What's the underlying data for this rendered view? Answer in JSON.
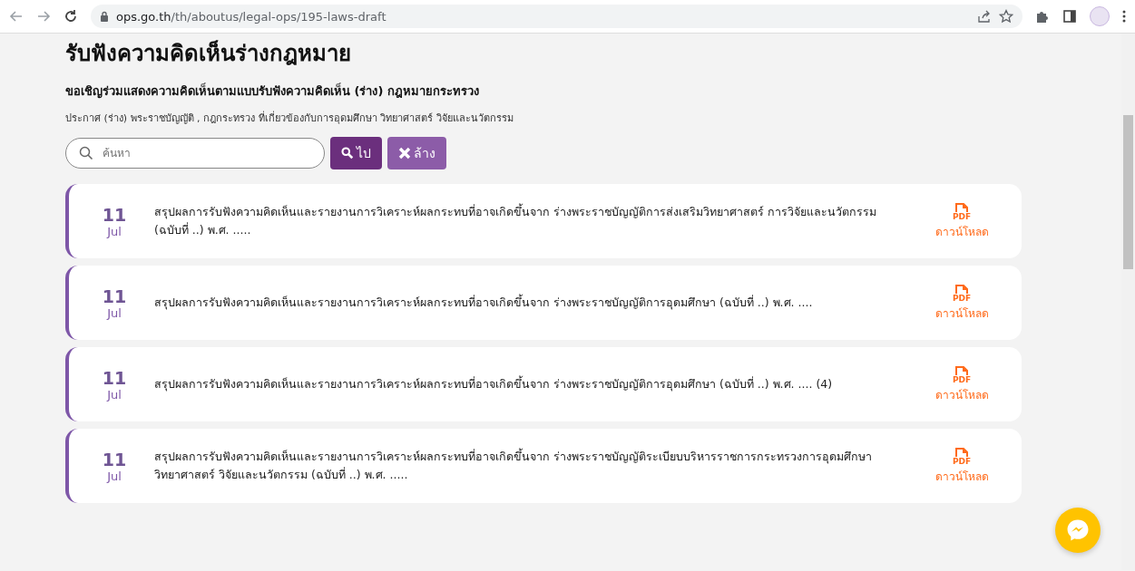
{
  "browser": {
    "url_host": "ops.go.th",
    "url_path": "/th/aboutus/legal-ops/195-laws-draft"
  },
  "page": {
    "title": "รับฟังความคิดเห็นร่างกฎหมาย",
    "subtitle": "ขอเชิญร่วมแสดงความคิดเห็นตามแบบรับฟังความคิดเห็น (ร่าง) กฎหมายกระทรวง",
    "description": "ประกาศ (ร่าง) พระราชบัญญัติ , กฎกระทรวง ที่เกี่ยวข้องกับการอุดมศึกษา วิทยาศาสตร์ วิจัยและนวัตกรรม"
  },
  "search": {
    "placeholder": "ค้นหา",
    "go_button": "ไป",
    "clear_button": "ล้าง"
  },
  "items": [
    {
      "day": "11",
      "month": "Jul",
      "title": "สรุปผลการรับฟังความคิดเห็นและรายงานการวิเคราะห์ผลกระทบที่อาจเกิดขึ้นจาก ร่างพระราชบัญญัติการส่งเสริมวิทยาศาสตร์ การวิจัยและนวัตกรรม (ฉบับที่ ..) พ.ศ. .....",
      "pdf_label": "PDF",
      "download": "ดาวน์โหลด"
    },
    {
      "day": "11",
      "month": "Jul",
      "title": "สรุปผลการรับฟังความคิดเห็นและรายงานการวิเคราะห์ผลกระทบที่อาจเกิดขึ้นจาก ร่างพระราชบัญญัติการอุดมศึกษา (ฉบับที่ ..) พ.ศ. ....",
      "pdf_label": "PDF",
      "download": "ดาวน์โหลด"
    },
    {
      "day": "11",
      "month": "Jul",
      "title": "สรุปผลการรับฟังความคิดเห็นและรายงานการวิเคราะห์ผลกระทบที่อาจเกิดขึ้นจาก ร่างพระราชบัญญัติการอุดมศึกษา (ฉบับที่ ..) พ.ศ. .... (4)",
      "pdf_label": "PDF",
      "download": "ดาวน์โหลด"
    },
    {
      "day": "11",
      "month": "Jul",
      "title": "สรุปผลการรับฟังความคิดเห็นและรายงานการวิเคราะห์ผลกระทบที่อาจเกิดขึ้นจาก ร่างพระราชบัญญัติระเบียบบริหารราชการกระทรวงการอุดมศึกษา วิทยาศาสตร์ วิจัยและนวัตกรรม (ฉบับที่ ..) พ.ศ. .....",
      "pdf_label": "PDF",
      "download": "ดาวน์โหลด"
    }
  ]
}
